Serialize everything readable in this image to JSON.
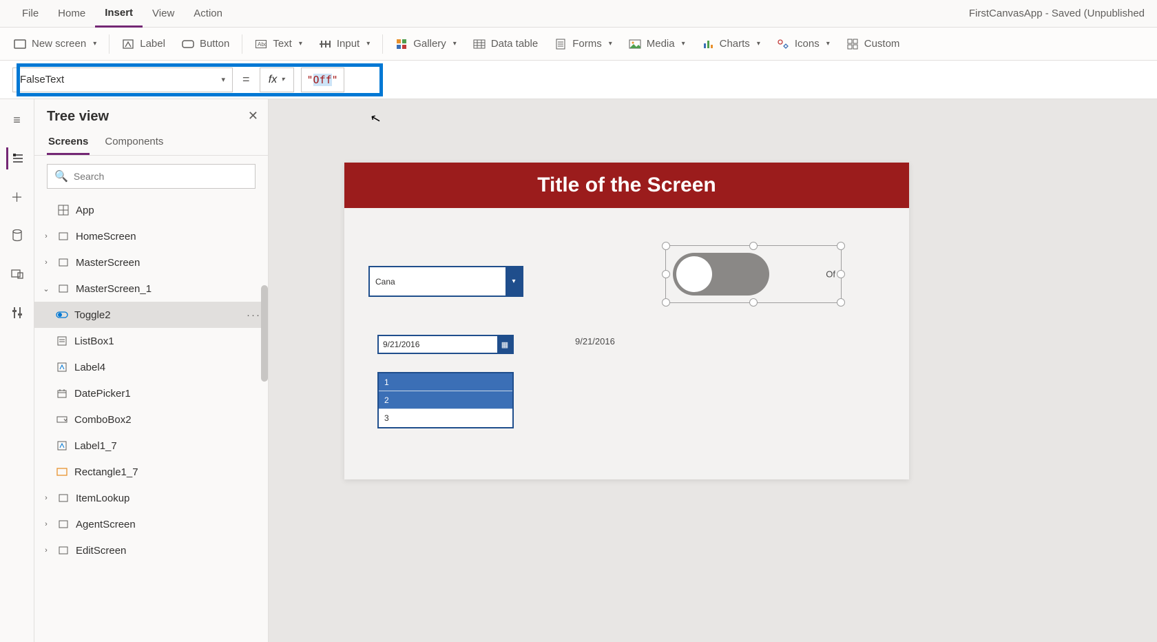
{
  "app_title": "FirstCanvasApp - Saved (Unpublished",
  "menus": {
    "file": "File",
    "home": "Home",
    "insert": "Insert",
    "view": "View",
    "action": "Action"
  },
  "ribbon": {
    "new_screen": "New screen",
    "label": "Label",
    "button": "Button",
    "text": "Text",
    "input": "Input",
    "gallery": "Gallery",
    "data_table": "Data table",
    "forms": "Forms",
    "media": "Media",
    "charts": "Charts",
    "icons": "Icons",
    "custom": "Custom"
  },
  "formula": {
    "property": "FalseText",
    "equals": "=",
    "fx": "fx",
    "quote_open": "\"",
    "value": "Off",
    "quote_close": "\""
  },
  "tree": {
    "title": "Tree view",
    "tabs": {
      "screens": "Screens",
      "components": "Components"
    },
    "search_placeholder": "Search",
    "app": "App",
    "items": {
      "home": "HomeScreen",
      "master": "MasterScreen",
      "master1": "MasterScreen_1",
      "toggle2": "Toggle2",
      "listbox1": "ListBox1",
      "label4": "Label4",
      "datepicker1": "DatePicker1",
      "combobox2": "ComboBox2",
      "label1_7": "Label1_7",
      "rectangle1_7": "Rectangle1_7",
      "itemlookup": "ItemLookup",
      "agentscreen": "AgentScreen",
      "editscreen": "EditScreen"
    },
    "more": "···"
  },
  "canvas": {
    "screen_title": "Title of the Screen",
    "combo_value": "Cana",
    "date_value": "9/21/2016",
    "date_label": "9/21/2016",
    "list": {
      "i1": "1",
      "i2": "2",
      "i3": "3"
    },
    "toggle_off_label": "Of"
  }
}
